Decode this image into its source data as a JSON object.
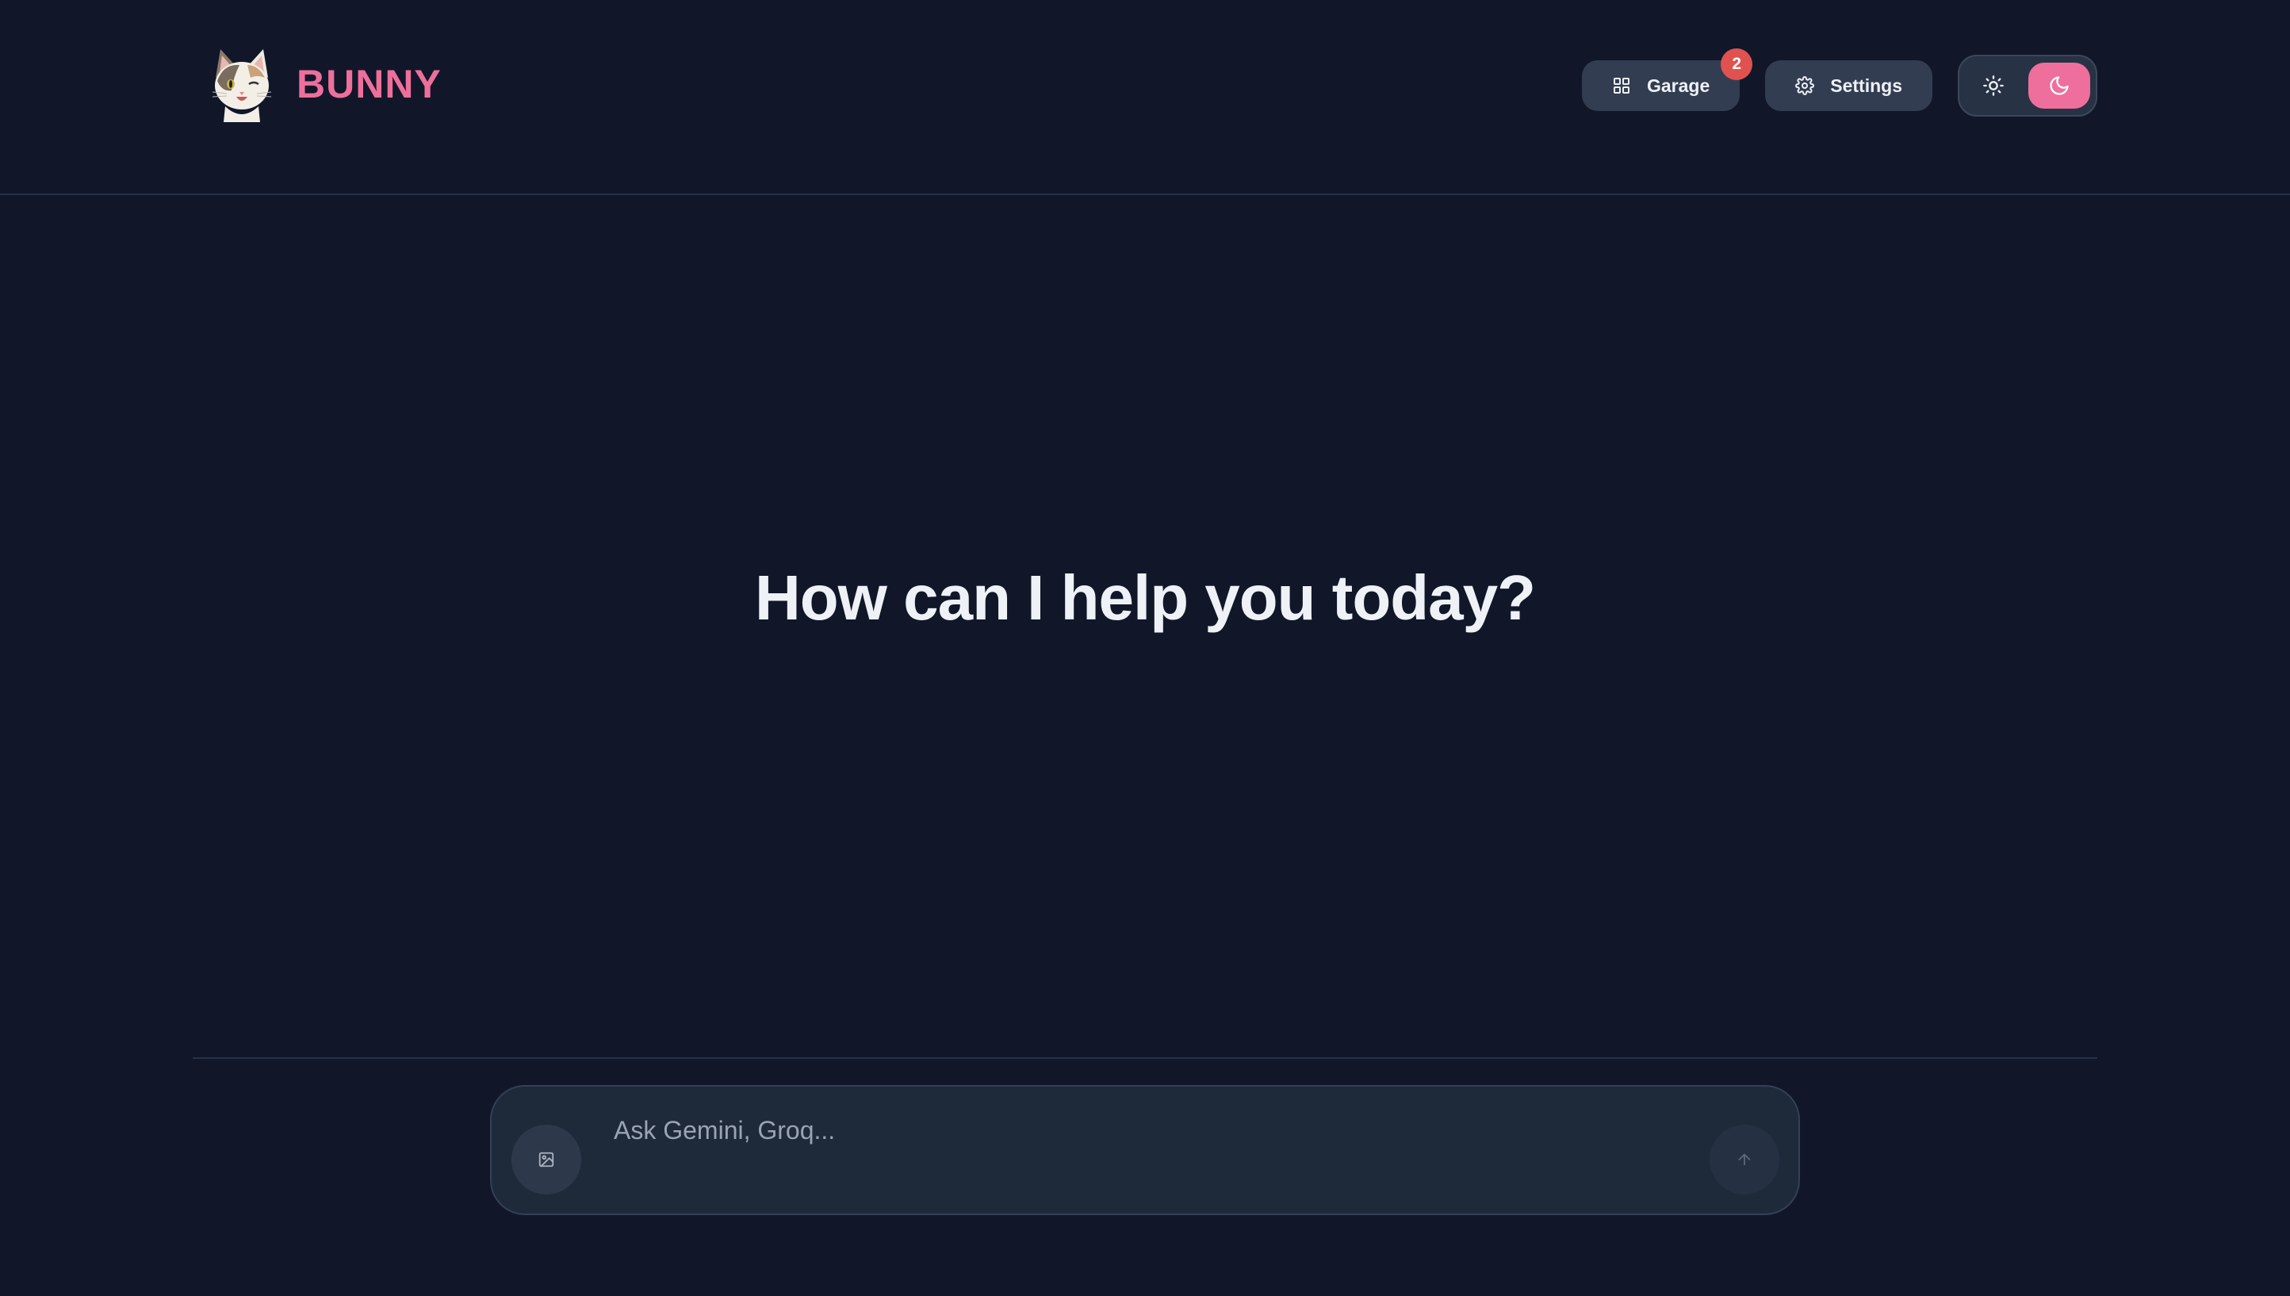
{
  "app": {
    "name": "BUNNY"
  },
  "header": {
    "garage_label": "Garage",
    "garage_badge": "2",
    "settings_label": "Settings",
    "theme": {
      "options": [
        "light",
        "dark"
      ],
      "selected": "dark"
    }
  },
  "main": {
    "greeting": "How can I help you today?"
  },
  "composer": {
    "placeholder": "Ask Gemini, Groq..."
  },
  "icons": {
    "logo": "cat-face-icon",
    "garage": "grid-icon",
    "settings": "gear-icon",
    "light_theme": "sun-icon",
    "dark_theme": "moon-icon",
    "image_upload": "image-icon",
    "send": "arrow-up-icon"
  },
  "colors": {
    "background": "#111729",
    "brand_pink": "#ee6f9c",
    "badge_red": "#e0524f",
    "active_toggle": "#ee6f9c",
    "text_primary": "#eef1f6",
    "text_placeholder": "#9aa3b2"
  }
}
